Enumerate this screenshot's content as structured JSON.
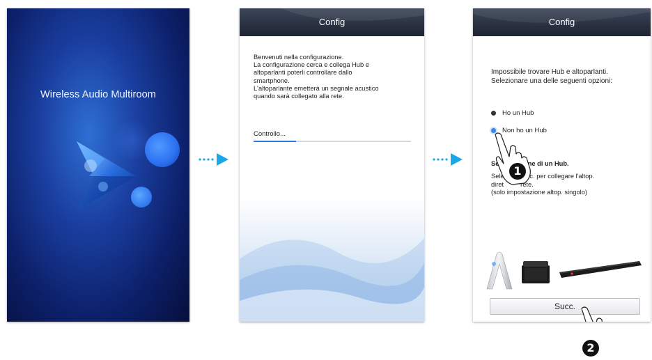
{
  "splash": {
    "title": "Wireless Audio Multiroom"
  },
  "screen2": {
    "header": "Config",
    "welcome_lines": [
      "Benvenuti nella configurazione.",
      "La configurazione cerca e collega Hub e",
      "altoparlanti poterli controllare dallo",
      "smartphone.",
      "L'altoparlante emetterà un segnale acustico",
      "quando sarà collegato alla rete."
    ],
    "status": "Controllo...",
    "progress": 0.27
  },
  "screen3": {
    "header": "Config",
    "not_found_lines": [
      "Impossibile trovare Hub e altoparlanti.",
      "Selezionare una delle seguenti opzioni:"
    ],
    "option_hub": "Ho un Hub",
    "option_no_hub": "Non ho un Hub",
    "selected_option": "Non ho un Hub",
    "section_title": "Se",
    "section_title_tail": "pone di un Hub.",
    "description_lines": [
      "Sele",
      "diret",
      "(solo impostazione altop. singolo)"
    ],
    "description_line1_tail": "ucc. per collegare l'altop.",
    "description_line2_tail": "rete.",
    "next_button": "Succ."
  },
  "steps": {
    "step1": "1",
    "step2": "2"
  },
  "colors": {
    "accent": "#2d7be0",
    "arrow": "#1ba7e6",
    "header": "#2a3242"
  }
}
